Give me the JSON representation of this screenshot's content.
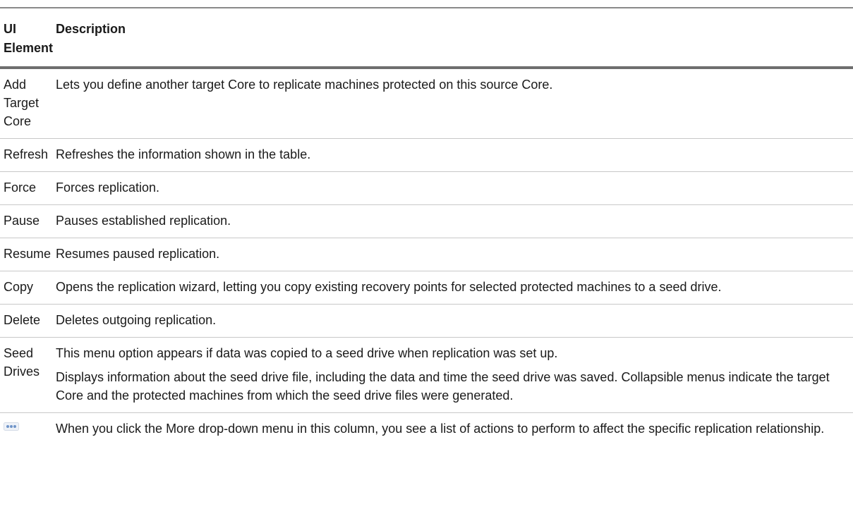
{
  "table": {
    "headers": {
      "ui_element": "UI Element",
      "description": "Description"
    },
    "rows": [
      {
        "ui": "Add Target Core",
        "description": [
          "Lets you define another target Core to replicate machines protected on this source Core."
        ]
      },
      {
        "ui": "Refresh",
        "description": [
          "Refreshes the information shown in the table."
        ]
      },
      {
        "ui": "Force",
        "description": [
          "Forces replication."
        ]
      },
      {
        "ui": "Pause",
        "description": [
          "Pauses established replication."
        ]
      },
      {
        "ui": "Resume",
        "description": [
          "Resumes paused replication."
        ]
      },
      {
        "ui": "Copy",
        "description": [
          "Opens the replication wizard, letting you copy existing recovery points for selected protected machines to a seed drive."
        ]
      },
      {
        "ui": "Delete",
        "description": [
          "Deletes outgoing replication."
        ]
      },
      {
        "ui": "Seed Drives",
        "description": [
          "This menu option appears if data was copied to a seed drive when replication was set up.",
          "Displays information about the seed drive file, including the data and time the seed drive was saved. Collapsible menus indicate the target Core and the protected machines from which the seed drive files were generated."
        ]
      },
      {
        "ui_icon": "more-dots-icon",
        "description": [
          "When you click the More drop-down menu in this column, you see a list of actions to perform to affect the specific replication relationship."
        ]
      }
    ]
  },
  "colors": {
    "icon_dots": "#6f94c8",
    "header_rule": "#6e6e6e",
    "row_rule": "#c8c8c8"
  }
}
